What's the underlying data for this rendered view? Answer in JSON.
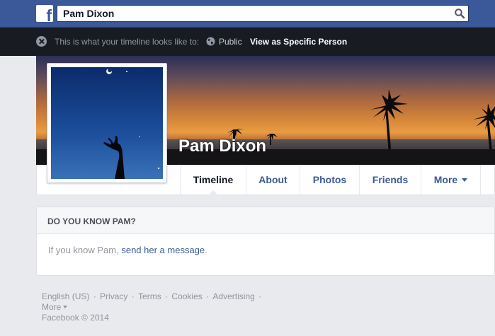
{
  "search": {
    "value": "Pam Dixon"
  },
  "viewbar": {
    "message": "This is what your timeline looks like to:",
    "audience": "Public",
    "view_as": "View as Specific Person"
  },
  "profile": {
    "name": "Pam Dixon"
  },
  "nav": {
    "tabs": [
      {
        "label": "Timeline",
        "active": true
      },
      {
        "label": "About"
      },
      {
        "label": "Photos"
      },
      {
        "label": "Friends"
      },
      {
        "label": "More"
      }
    ]
  },
  "card": {
    "title": "DO YOU KNOW PAM?",
    "text_before": "If you know Pam,",
    "link": "send her a message",
    "text_after": "."
  },
  "footer": {
    "links": [
      "English (US)",
      "Privacy",
      "Terms",
      "Cookies",
      "Advertising"
    ],
    "more": "More",
    "copyright": "Facebook © 2014"
  },
  "colors": {
    "brand": "#3b5998",
    "link": "#3b5998",
    "viewbar_bg": "#181b22"
  },
  "icons": [
    "facebook-logo",
    "search-icon",
    "close-icon",
    "globe-icon",
    "chevron-down-icon"
  ]
}
